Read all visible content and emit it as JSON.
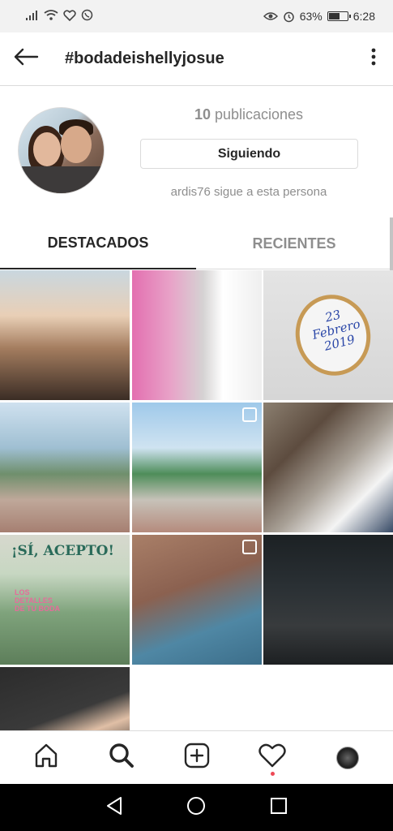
{
  "status_bar": {
    "battery": "63%",
    "battery_level": 0.63,
    "time": "6:28"
  },
  "header": {
    "title": "#bodadeishellyjosue",
    "back_icon": "arrow-left-icon",
    "more_icon": "vertical-dots-icon"
  },
  "profile": {
    "posts_count": "10",
    "posts_label": "publicaciones",
    "follow_button": "Siguiendo",
    "follow_note": "ardis76 sigue a esta persona"
  },
  "tabs": [
    {
      "label": "DESTACADOS",
      "active": true
    },
    {
      "label": "RECIENTES",
      "active": false
    }
  ],
  "grid": {
    "ring_text": [
      "23",
      "Febrero",
      "2019"
    ],
    "card_title": "¡SÍ, ACEPTO!",
    "card_sub": "LOS DETALLES DE TU BODA"
  },
  "bottom_nav": [
    "home-icon",
    "search-icon",
    "add-post-icon",
    "heart-icon",
    "profile-avatar"
  ],
  "colors": {
    "notification_dot": "#ed4956",
    "text_primary": "#262626",
    "text_secondary": "#8e8e8e"
  }
}
